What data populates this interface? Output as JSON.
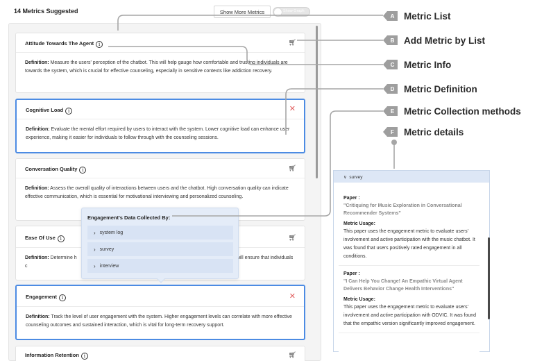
{
  "header": {
    "title": "14 Metrics Suggested",
    "show_more_label": "Show More Metrics",
    "toggle_label": "Show Graph",
    "toggle_on": false
  },
  "metrics": [
    {
      "name": "Attitude Towards The Agent",
      "action": "cart",
      "selected": false,
      "definition_label": "Definition:",
      "definition": " Measure the users' perception of the chatbot. This will help gauge how comfortable and trusting individuals are towards the system, which is crucial for effective counseling, especially in sensitive contexts like addiction recovery."
    },
    {
      "name": "Cognitive Load",
      "action": "remove",
      "selected": true,
      "definition_label": "Definition:",
      "definition": " Evaluate the mental effort required by users to interact with the system. Lower cognitive load can enhance user experience, making it easier for individuals to follow through with the counseling sessions."
    },
    {
      "name": "Conversation Quality",
      "action": "cart",
      "selected": false,
      "definition_label": "Definition:",
      "definition": " Assess the overall quality of interactions between users and the chatbot. High conversation quality can indicate effective communication, which is essential for motivational interviewing and personalized counseling."
    },
    {
      "name": "Ease Of Use",
      "action": "cart",
      "selected": false,
      "definition_label": "Definition:",
      "definition": " Determine h                                                                                          sers, ease of use will ensure that individuals c                                                                                         l stress."
    },
    {
      "name": "Engagement",
      "action": "remove",
      "selected": true,
      "definition_label": "Definition:",
      "definition": " Track the level of user engagement with the system. Higher engagement levels can correlate with more effective counseling outcomes and sustained interaction, which is vital for long-term recovery support."
    },
    {
      "name": "Information Retention",
      "action": "cart",
      "selected": false,
      "definition_label": "",
      "definition": ""
    }
  ],
  "icons": {
    "info": "info-circle-icon",
    "cart": "cart-icon",
    "remove": "close-icon",
    "expand": "chevron-right-icon",
    "collapse": "chevron-down-icon"
  },
  "popup": {
    "title": "Engagement's Data Collected By:",
    "methods": [
      "system log",
      "survey",
      "interview"
    ]
  },
  "legend": [
    {
      "letter": "A",
      "label": "Metric List"
    },
    {
      "letter": "B",
      "label": "Add Metric by List"
    },
    {
      "letter": "C",
      "label": "Metric Info"
    },
    {
      "letter": "D",
      "label": "Metric Definition"
    },
    {
      "letter": "E",
      "label": "Metric Collection methods"
    },
    {
      "letter": "F",
      "label": "Metric details"
    }
  ],
  "details": {
    "section": "survey",
    "papers": [
      {
        "paper_label": "Paper :",
        "title": "\"Critiquing for Music Exploration in Conversational Recommender Systems\"",
        "usage_label": "Metric Usage:",
        "usage": "This paper uses the engagement metric to evaluate users' involvement and active participation with the music chatbot. It was found that users positively rated engagement in all conditions."
      },
      {
        "paper_label": "Paper :",
        "title": "\"I Can Help You Change! An Empathic Virtual Agent Delivers Behavior Change Health Interventions\"",
        "usage_label": "Metric Usage:",
        "usage": "This paper uses the engagement metric to evaluate users' involvement and active participation with ODVIC. It was found that the empathic version significantly improved engagement."
      }
    ]
  },
  "colors": {
    "selected_border": "#4c8be3",
    "remove_icon": "#e05a5a",
    "popup_bg": "#e4ecf8",
    "legend_badge": "#9e9e9e"
  }
}
